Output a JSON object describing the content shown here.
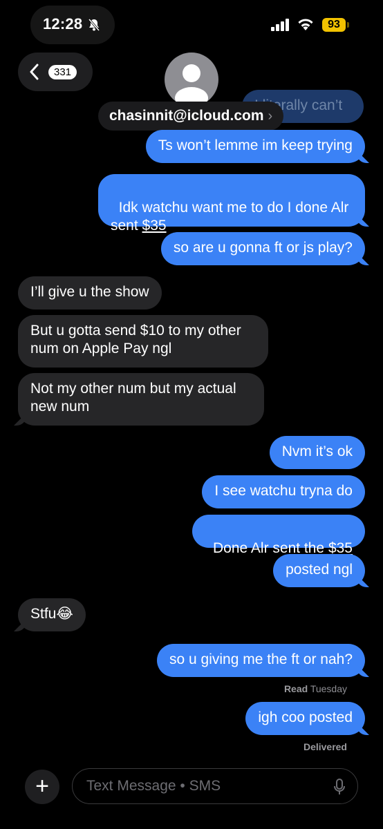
{
  "status_bar": {
    "time": "12:28",
    "battery": "93"
  },
  "header": {
    "unread_count": "331",
    "contact": "chasinnit@icloud.com",
    "arrow": "›"
  },
  "messages": [
    {
      "side": "out",
      "text": "I literally can’t"
    },
    {
      "side": "out",
      "text": "Ts won’t lemme im keep trying"
    },
    {
      "side": "out",
      "text_before": "Idk watchu want me to do I done Alr\nsent ",
      "link": "$35"
    },
    {
      "side": "out",
      "text": "so are u gonna ft or js play?"
    },
    {
      "side": "in",
      "text": "I’ll give u the show"
    },
    {
      "side": "in",
      "text": "But u gotta send $10 to my other\nnum on Apple Pay ngl"
    },
    {
      "side": "in",
      "text": "Not my other num but my actual\nnew num"
    },
    {
      "side": "out",
      "text": "Nvm it’s ok"
    },
    {
      "side": "out",
      "text": "I see watchu tryna do"
    },
    {
      "side": "out",
      "text_before": "Done Alr sent the ",
      "link": "$35"
    },
    {
      "side": "out",
      "text": "posted ngl"
    },
    {
      "side": "in",
      "text": "Stfu😂"
    },
    {
      "side": "out",
      "text": "so u giving me the ft or nah?"
    },
    {
      "side": "out",
      "text": "igh coo posted"
    }
  ],
  "receipts": {
    "read_label": "Read",
    "read_day": "Tuesday",
    "delivered": "Delivered"
  },
  "composer": {
    "plus": "+",
    "placeholder": "Text Message • SMS"
  },
  "colors": {
    "outgoing": "#3b82f6",
    "incoming": "#262628",
    "battery": "#f2c200"
  }
}
